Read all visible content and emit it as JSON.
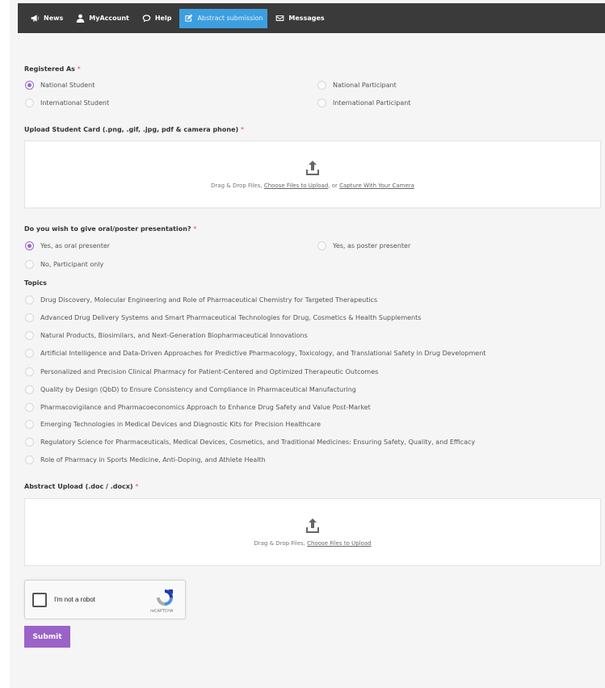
{
  "nav": {
    "items": [
      {
        "label": "News",
        "icon": "megaphone-icon"
      },
      {
        "label": "MyAccount",
        "icon": "user-icon"
      },
      {
        "label": "Help",
        "icon": "chat-icon"
      },
      {
        "label": "Abstract submission",
        "icon": "edit-icon",
        "active": true
      },
      {
        "label": "Messages",
        "icon": "envelope-icon"
      }
    ],
    "active_color": "#3d9fe0",
    "bar_color": "#3a3a3a"
  },
  "registered": {
    "label": "Registered As",
    "required_mark": "*",
    "options": [
      "National Student",
      "National Participant",
      "International Student",
      "International Participant"
    ],
    "selected": "National Student"
  },
  "student_card": {
    "label": "Upload Student Card (.png, .gif, .jpg, pdf & camera phone)",
    "required_mark": "*",
    "text_prefix": "Drag & Drop Files,",
    "link_choose": "Choose Files to Upload",
    "text_or": ", or",
    "link_camera": "Capture With Your Camera"
  },
  "presentation": {
    "label": "Do you wish to give oral/poster presentation?",
    "required_mark": "*",
    "options": [
      "Yes, as oral presenter",
      "Yes, as poster presenter",
      "No, Participant only"
    ],
    "selected": "Yes, as oral presenter"
  },
  "topics": {
    "label": "Topics",
    "options": [
      "Drug Discovery, Molecular Engineering and Role of Pharmaceutical Chemistry for Targeted Therapeutics",
      "Advanced Drug Delivery Systems and Smart Pharmaceutical Technologies for Drug, Cosmetics & Health Supplements",
      "Natural Products, Biosimilars, and Next-Generation Biopharmaceutical Innovations",
      "Artificial Intelligence and Data-Driven Approaches for Predictive Pharmacology, Toxicology, and Translational Safety in Drug Development",
      "Personalized and Precision Clinical Pharmacy for Patient-Centered and Optimized Therapeutic Outcomes",
      "Quality by Design (QbD) to Ensure Consistency and Compliance in Pharmaceutical Manufacturing",
      "Pharmacovigilance and Pharmacoeconomics Approach to Enhance Drug Safety and Value Post-Market",
      "Emerging Technologies in Medical Devices and Diagnostic Kits for Precision Healthcare",
      "Regulatory Science for Pharmaceuticals, Medical Devices, Cosmetics, and Traditional Medicines: Ensuring Safety, Quality, and Efficacy",
      "Role of Pharmacy in Sports Medicine, Anti-Doping, and Athlete Health"
    ]
  },
  "abstract": {
    "label": "Abstract Upload (.doc / .docx)",
    "required_mark": "*",
    "text_prefix": "Drag & Drop Files,",
    "link_choose": "Choose Files to Upload"
  },
  "captcha": {
    "label": "I'm not a robot",
    "brand": "reCAPTCHA"
  },
  "submit": {
    "label": "Submit",
    "color": "#9b62c8"
  },
  "accent_color": "#9a67c9"
}
